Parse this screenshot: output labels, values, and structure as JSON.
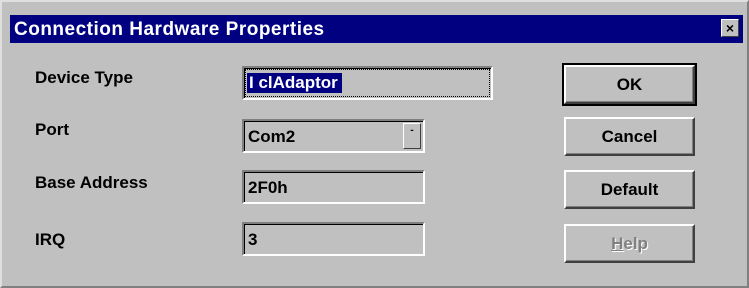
{
  "window": {
    "title": "Connection Hardware Properties",
    "close_glyph": "×"
  },
  "fields": {
    "device_type": {
      "label": "Device Type",
      "value": "I clAdaptor"
    },
    "port": {
      "label": "Port",
      "value": "Com2"
    },
    "base_address": {
      "label": "Base Address",
      "value": "2F0h"
    },
    "irq": {
      "label": "IRQ",
      "value": "3"
    }
  },
  "buttons": {
    "ok": "OK",
    "cancel": "Cancel",
    "default": "Default",
    "help_mnemonic": "H",
    "help_rest": "elp"
  },
  "state": {
    "help_enabled": false
  }
}
